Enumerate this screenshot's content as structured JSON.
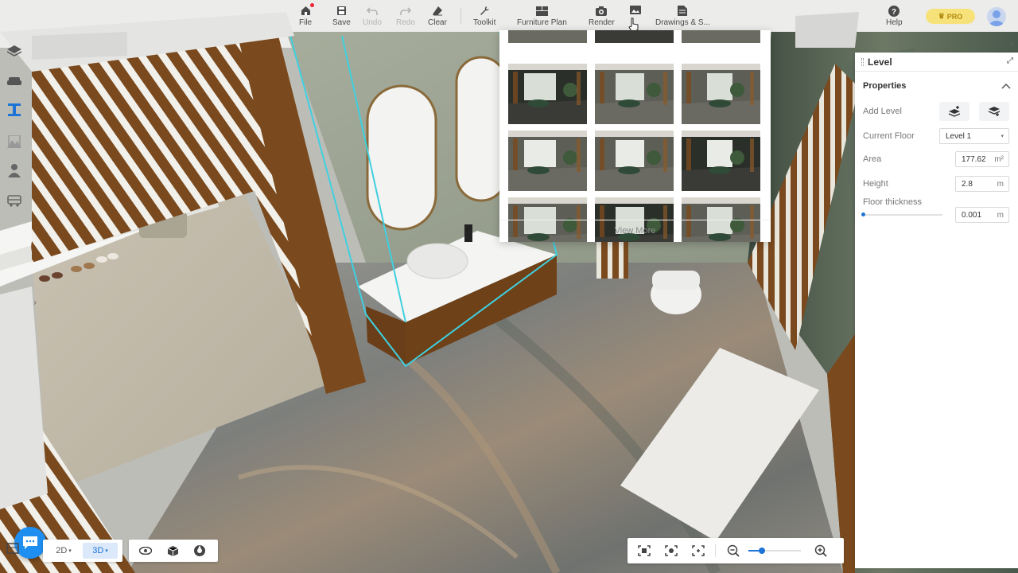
{
  "toolbar": {
    "file": "File",
    "save": "Save",
    "undo": "Undo",
    "redo": "Redo",
    "clear": "Clear",
    "toolkit": "Toolkit",
    "furniture_plan": "Furniture Plan",
    "render": "Render",
    "drawings": "Drawings & S...",
    "help": "Help",
    "pro_badge": "PRO"
  },
  "render_popup": {
    "view_more": "View More"
  },
  "panel": {
    "title": "Level",
    "section": "Properties",
    "add_level_label": "Add Level",
    "current_floor_label": "Current Floor",
    "current_floor_value": "Level 1",
    "area_label": "Area",
    "area_value": "177.62",
    "area_unit": "m²",
    "height_label": "Height",
    "height_value": "2.8",
    "height_unit": "m",
    "floor_thickness_label": "Floor thickness",
    "floor_thickness_value": "0.001",
    "floor_thickness_unit": "m"
  },
  "view_mode": {
    "mode_2d": "2D",
    "mode_3d": "3D",
    "active": "3D"
  },
  "zoom": {
    "level": 0.25
  }
}
